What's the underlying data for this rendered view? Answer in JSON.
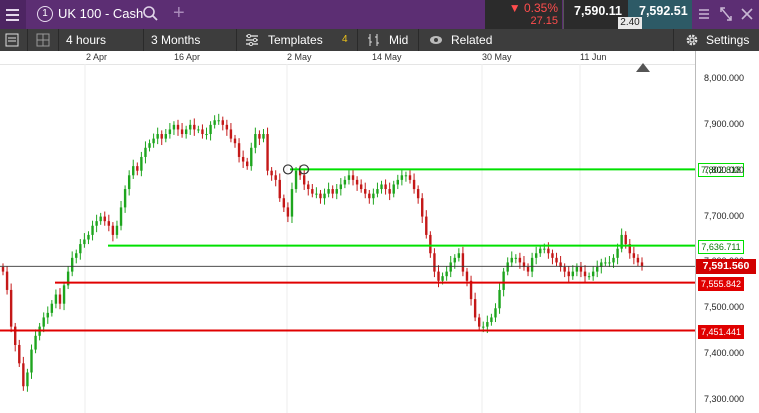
{
  "header": {
    "menu_icon": "hamburger-icon",
    "instrument_index": "1",
    "instrument_name": "UK 100 - Cash",
    "search_icon": "search-icon",
    "add_icon": "plus-icon",
    "change_percent": "▼ 0.35%",
    "change_points": "27.15",
    "sell_price": "7,590.11",
    "spread": "2.40",
    "buy_price": "7,592.51",
    "window_controls": [
      "collapse-icon",
      "expand-icon",
      "close-icon"
    ]
  },
  "toolbar": {
    "timeframe": "4 hours",
    "range": "3 Months",
    "templates": "Templates",
    "indicator_count": "4",
    "price_type": "Mid",
    "related": "Related",
    "settings": "Settings"
  },
  "x_axis": {
    "labels": [
      "2 Apr",
      "16 Apr",
      "2 May",
      "14 May",
      "30 May",
      "11 Jun"
    ]
  },
  "chart_data": {
    "type": "candlestick",
    "ylim": [
      7300,
      8000
    ],
    "y_ticks": [
      "8,000.000",
      "7,900.000",
      "7,800.000",
      "7,700.000",
      "7,600.000",
      "7,500.000",
      "7,400.000",
      "7,300.000"
    ],
    "y_tick_values": [
      8000,
      7900,
      7800,
      7700,
      7600,
      7500,
      7400,
      7300
    ],
    "current_price": "7,591.560",
    "current_value": 7591.56,
    "horizontal_lines": [
      {
        "label": "7,802.818",
        "value": 7802.818,
        "color": "#00e000"
      },
      {
        "label": "7,636.711",
        "value": 7636.711,
        "color": "#00e000"
      },
      {
        "label": "7,555.842",
        "value": 7555.842,
        "color": "#e00000"
      },
      {
        "label": "7,451.441",
        "value": 7451.441,
        "color": "#e00000"
      }
    ],
    "series": [
      {
        "values": [
          7580,
          7540,
          7460,
          7420,
          7380,
          7330,
          7360,
          7410,
          7440,
          7460,
          7480,
          7490,
          7510,
          7530,
          7510,
          7550,
          7580,
          7610,
          7620,
          7640,
          7650,
          7660,
          7680,
          7690,
          7700,
          7690,
          7680,
          7660,
          7680,
          7720,
          7760,
          7790,
          7810,
          7800,
          7830,
          7850,
          7860,
          7870,
          7880,
          7870,
          7880,
          7890,
          7900,
          7890,
          7880,
          7890,
          7900,
          7890,
          7890,
          7880,
          7880,
          7900,
          7910,
          7910,
          7900,
          7890,
          7870,
          7860,
          7830,
          7820,
          7810,
          7850,
          7880,
          7870,
          7880,
          7800,
          7790,
          7780,
          7740,
          7720,
          7700,
          7760,
          7800,
          7790,
          7770,
          7760,
          7750,
          7750,
          7740,
          7750,
          7760,
          7750,
          7760,
          7770,
          7780,
          7790,
          7780,
          7770,
          7760,
          7750,
          7740,
          7750,
          7760,
          7770,
          7760,
          7750,
          7770,
          7780,
          7790,
          7790,
          7780,
          7760,
          7740,
          7700,
          7660,
          7620,
          7580,
          7560,
          7570,
          7580,
          7600,
          7610,
          7620,
          7580,
          7560,
          7520,
          7480,
          7460,
          7460,
          7470,
          7480,
          7500,
          7540,
          7580,
          7600,
          7610,
          7610,
          7600,
          7590,
          7580,
          7610,
          7620,
          7630,
          7630,
          7620,
          7610,
          7600,
          7590,
          7580,
          7570,
          7580,
          7590,
          7580,
          7570,
          7570,
          7580,
          7590,
          7600,
          7600,
          7600,
          7610,
          7630,
          7660,
          7640,
          7620,
          7610,
          7600,
          7592
        ]
      }
    ]
  }
}
